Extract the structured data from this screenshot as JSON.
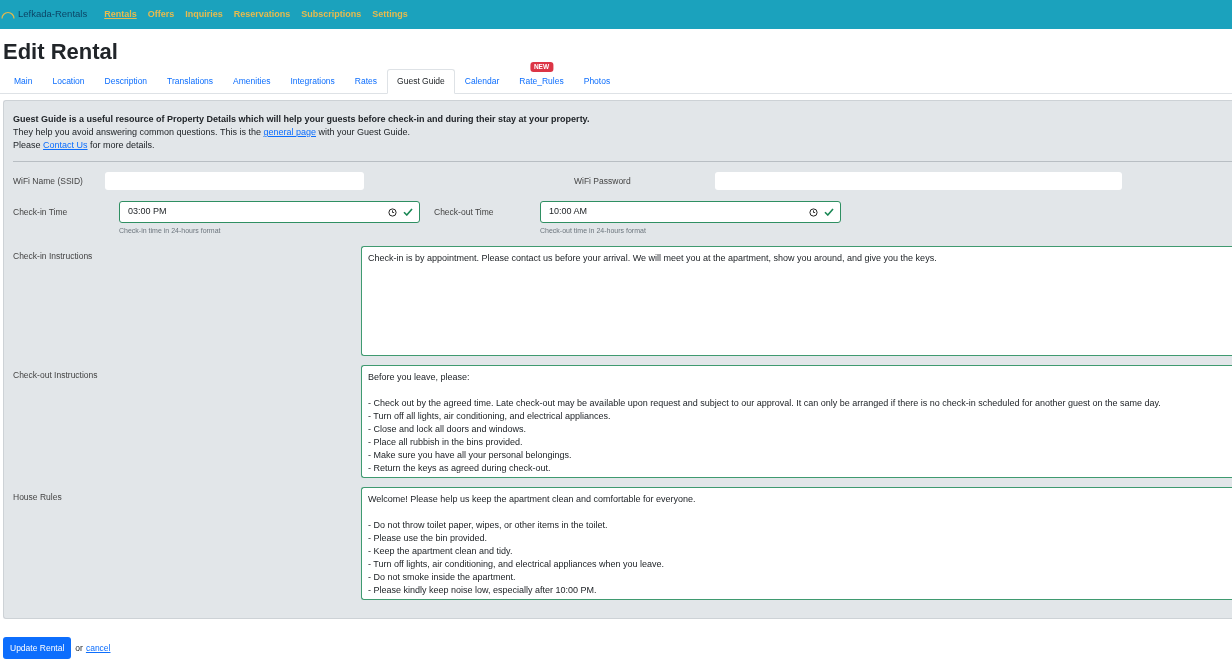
{
  "navbar": {
    "brand": "Lefkada-Rentals",
    "links": [
      {
        "label": "Rentals",
        "selected": true
      },
      {
        "label": "Offers",
        "selected": false
      },
      {
        "label": "Inquiries",
        "selected": false
      },
      {
        "label": "Reservations",
        "selected": false
      },
      {
        "label": "Subscriptions",
        "selected": false
      },
      {
        "label": "Settings",
        "selected": false
      }
    ]
  },
  "title": "Edit Rental",
  "tabs": [
    {
      "label": "Main",
      "selected": false
    },
    {
      "label": "Location",
      "selected": false
    },
    {
      "label": "Description",
      "selected": false
    },
    {
      "label": "Translations",
      "selected": false
    },
    {
      "label": "Amenities",
      "selected": false
    },
    {
      "label": "Integrations",
      "selected": false
    },
    {
      "label": "Rates",
      "selected": false
    },
    {
      "label": "Guest Guide",
      "selected": true
    },
    {
      "label": "Calendar",
      "selected": false
    },
    {
      "label": "Rate_Rules",
      "selected": false,
      "badge": "NEW"
    },
    {
      "label": "Photos",
      "selected": false
    }
  ],
  "guest_guide": {
    "heading": "Guest Guide is a useful resource of Property Details which will help your guests before check-in and during their stay at your property.",
    "lines": [
      {
        "before": "They help you avoid answering common questions. This is the ",
        "link": "general page",
        "after": " with your Guest Guide."
      },
      {
        "before": "Please ",
        "link": "Contact Us",
        "after": " for more details."
      }
    ],
    "wifi": [
      {
        "label": "WiFi Name (SSID)"
      },
      {
        "label": "WiFi Password"
      }
    ],
    "times": [
      {
        "label": "Check-in Time",
        "value": "03:00 PM",
        "valid": true,
        "help": "Check-in time in 24-hours format"
      },
      {
        "label": "Check-out Time",
        "value": "10:00 AM",
        "valid": true,
        "help": "Check-out time in 24-hours format"
      }
    ],
    "texts": [
      {
        "label": "Check-in Instructions",
        "valid": true,
        "value": "Check-in is by appointment. Please contact us before your arrival. We will meet you at the apartment, show you around, and give you the keys."
      },
      {
        "label": "Check-out Instructions",
        "valid": true,
        "value": "Before you leave, please:\n\n- Check out by the agreed time. Late check-out may be available upon request and subject to our approval. It can only be arranged if there is no check-in scheduled for another guest on the same day.\n- Turn off all lights, air conditioning, and electrical appliances.\n- Close and lock all doors and windows.\n- Place all rubbish in the bins provided.\n- Make sure you have all your personal belongings.\n- Return the keys as agreed during check-out."
      },
      {
        "label": "House Rules",
        "valid": true,
        "value": "Welcome! Please help us keep the apartment clean and comfortable for everyone.\n\n- Do not throw toilet paper, wipes, or other items in the toilet.\n- Please use the bin provided.\n- Keep the apartment clean and tidy.\n- Turn off lights, air conditioning, and electrical appliances when you leave.\n- Do not smoke inside the apartment.\n- Please kindly keep noise low, especially after 10:00 PM."
      }
    ]
  },
  "actions": {
    "submit": "Update Rental",
    "separator": "or",
    "cancel": "cancel"
  }
}
